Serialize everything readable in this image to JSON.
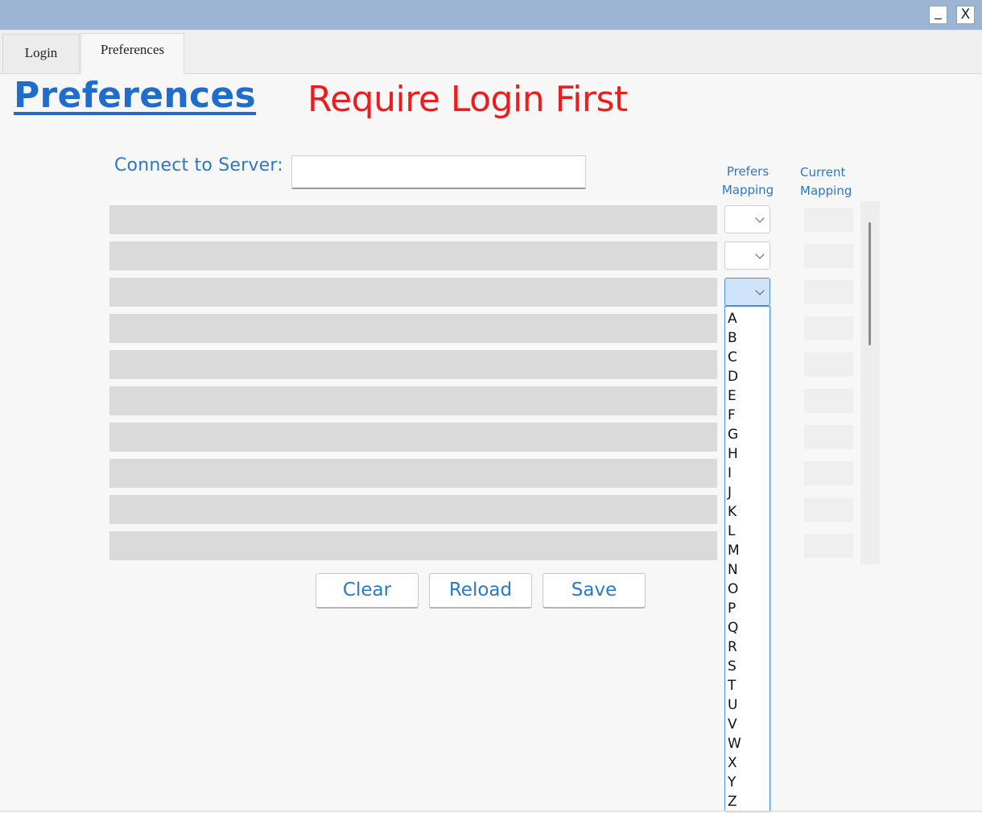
{
  "window": {
    "minimize_label": "_",
    "close_label": "X"
  },
  "tabs": [
    {
      "label": "Login"
    },
    {
      "label": "Preferences"
    }
  ],
  "page": {
    "title": "Preferences",
    "warning": "Require Login First",
    "server_label": "Connect to Server:",
    "server_value": ""
  },
  "columns": {
    "prefers": "Prefers Mapping",
    "current": "Current Mapping"
  },
  "rows": [
    {
      "name": "",
      "prefers": "",
      "current": ""
    },
    {
      "name": "",
      "prefers": "",
      "current": ""
    },
    {
      "name": "",
      "prefers": "",
      "current": ""
    },
    {
      "name": "",
      "prefers": "",
      "current": ""
    },
    {
      "name": "",
      "prefers": "",
      "current": ""
    },
    {
      "name": "",
      "prefers": "",
      "current": ""
    },
    {
      "name": "",
      "prefers": "",
      "current": ""
    },
    {
      "name": "",
      "prefers": "",
      "current": ""
    },
    {
      "name": "",
      "prefers": "",
      "current": ""
    },
    {
      "name": "",
      "prefers": "",
      "current": ""
    }
  ],
  "open_dropdown_row": 3,
  "dropdown_options": [
    "A",
    "B",
    "C",
    "D",
    "E",
    "F",
    "G",
    "H",
    "I",
    "J",
    "K",
    "L",
    "M",
    "N",
    "O",
    "P",
    "Q",
    "R",
    "S",
    "T",
    "U",
    "V",
    "W",
    "X",
    "Y",
    "Z"
  ],
  "buttons": {
    "clear": "Clear",
    "reload": "Reload",
    "save": "Save"
  },
  "colors": {
    "titlebar": "#9cb5d3",
    "accent_blue": "#1f6ccc",
    "warning_red": "#ee1c1c"
  }
}
